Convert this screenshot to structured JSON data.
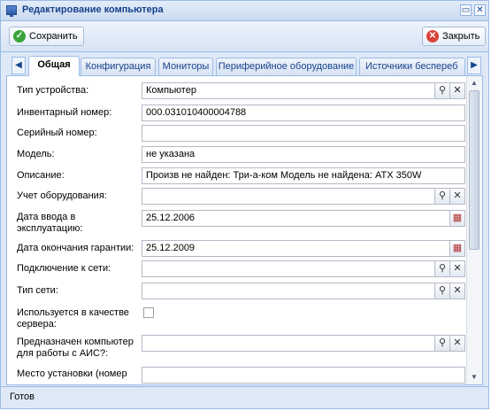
{
  "window": {
    "title": "Редактирование компьютера",
    "minimize_icon": "minimize-icon",
    "close_icon": "close-icon"
  },
  "toolbar": {
    "save_label": "Сохранить",
    "close_label": "Закрыть"
  },
  "tabs": [
    {
      "label": "Общая",
      "active": true
    },
    {
      "label": "Конфигурация"
    },
    {
      "label": "Мониторы"
    },
    {
      "label": "Периферийное оборудование"
    },
    {
      "label": "Источники беспереб"
    }
  ],
  "form": {
    "device_type": {
      "label": "Тип устройства:",
      "value": "Компьютер"
    },
    "inventory_number": {
      "label": "Инвентарный номер:",
      "value": "000.031010400004788"
    },
    "serial_number": {
      "label": "Серийный номер:",
      "value": ""
    },
    "model": {
      "label": "Модель:",
      "value": "не указана"
    },
    "description": {
      "label": "Описание:",
      "value": "Произв не найден: Три-а-ком Модель не найдена: ATX 350W"
    },
    "equipment_accounting": {
      "label": "Учет оборудования:",
      "value": ""
    },
    "commission_date": {
      "label": "Дата ввода в эксплуатацию:",
      "value": "25.12.2006"
    },
    "warranty_end_date": {
      "label": "Дата окончания гарантии:",
      "value": "25.12.2009"
    },
    "network_connection": {
      "label": "Подключение к сети:",
      "value": ""
    },
    "network_type": {
      "label": "Тип сети:",
      "value": ""
    },
    "used_as_server": {
      "label": "Используется в качестве сервера:",
      "checked": false
    },
    "ais_purpose": {
      "label": "Предназначен компьютер для работы с АИС?:",
      "value": ""
    },
    "install_location": {
      "label": "Место установки (номер",
      "value": ""
    }
  },
  "status": {
    "text": "Готов"
  },
  "colors": {
    "accent": "#15428b",
    "border": "#99bbe8",
    "save_icon": "#3aa53a",
    "close_icon": "#d9443a"
  }
}
